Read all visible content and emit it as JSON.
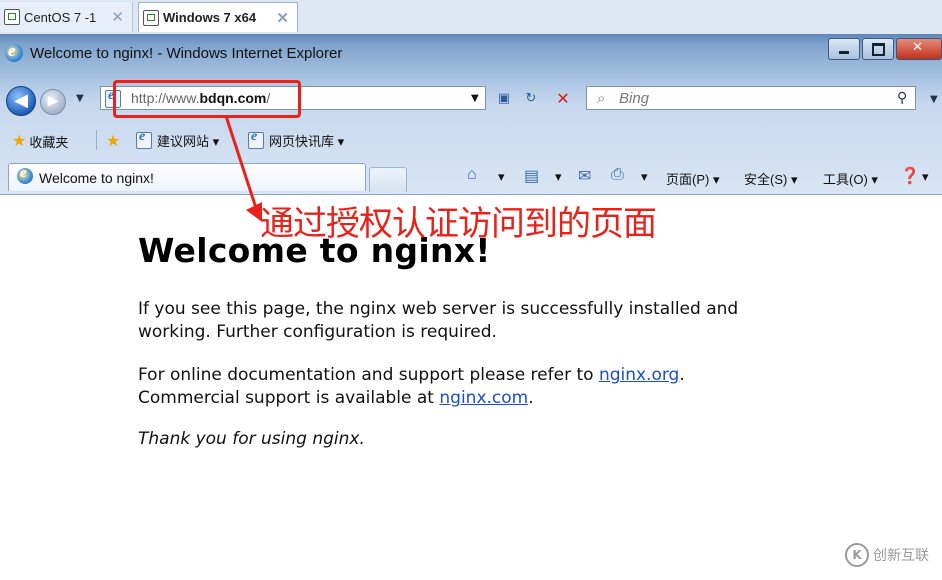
{
  "vm_tabs": [
    {
      "label": "CentOS 7 -1",
      "close": "✕"
    },
    {
      "label": "Windows 7 x64",
      "close": "✕"
    }
  ],
  "window": {
    "title": "Welcome to nginx! - Windows Internet Explorer"
  },
  "address_bar": {
    "url_prefix": "http://www.",
    "url_host": "bdqn.com",
    "url_suffix": "/"
  },
  "search": {
    "placeholder": "Bing"
  },
  "favorites": {
    "label": "收藏夹",
    "items": [
      {
        "label": "建议网站 ▾"
      },
      {
        "label": "网页快讯库 ▾"
      }
    ]
  },
  "tab": {
    "label": "Welcome to nginx!"
  },
  "commands": {
    "page": "页面(P) ▾",
    "safety": "安全(S) ▾",
    "tools": "工具(O) ▾"
  },
  "nginx_page": {
    "heading": "Welcome to nginx!",
    "p1": "If you see this page, the nginx web server is successfully installed and working. Further configuration is required.",
    "p2_a": "For online documentation and support please refer to ",
    "p2_link1": "nginx.org",
    "p2_b": ".",
    "p2_c": "Commercial support is available at ",
    "p2_link2": "nginx.com",
    "p2_d": ".",
    "p3": "Thank you for using nginx."
  },
  "annotation": {
    "text": "通过授权认证访问到的页面",
    "color": "#e8221a"
  },
  "watermark": {
    "text": "创新互联"
  }
}
